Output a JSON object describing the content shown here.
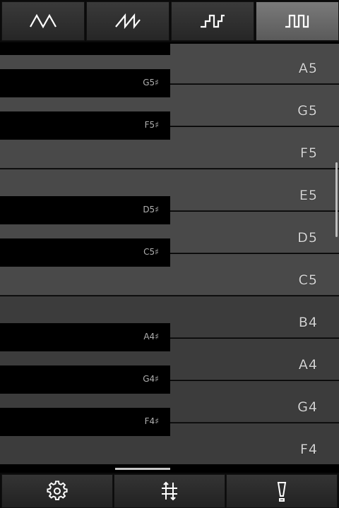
{
  "waveforms": [
    {
      "icon": "triangle-wave-icon",
      "selected": false
    },
    {
      "icon": "sawtooth-wave-icon",
      "selected": false
    },
    {
      "icon": "stepped-wave-icon",
      "selected": false
    },
    {
      "icon": "square-wave-icon",
      "selected": true
    }
  ],
  "white_keys": [
    {
      "label": "A5",
      "dim": false
    },
    {
      "label": "G5",
      "dim": false
    },
    {
      "label": "F5",
      "dim": false
    },
    {
      "label": "E5",
      "dim": false
    },
    {
      "label": "D5",
      "dim": false
    },
    {
      "label": "C5",
      "dim": false
    },
    {
      "label": "B4",
      "dim": true
    },
    {
      "label": "A4",
      "dim": true
    },
    {
      "label": "G4",
      "dim": true
    },
    {
      "label": "F4",
      "dim": true
    }
  ],
  "black_keys": [
    {
      "label": "G5♯",
      "above": 1
    },
    {
      "label": "F5♯",
      "above": 2
    },
    {
      "label": "D5♯",
      "above": 4
    },
    {
      "label": "C5♯",
      "above": 5
    },
    {
      "label": "A4♯",
      "above": 7
    },
    {
      "label": "G4♯",
      "above": 8
    },
    {
      "label": "F4♯",
      "above": 9
    }
  ],
  "bottom": [
    {
      "icon": "gear-icon"
    },
    {
      "icon": "sliders-icon"
    },
    {
      "icon": "metronome-icon"
    }
  ]
}
